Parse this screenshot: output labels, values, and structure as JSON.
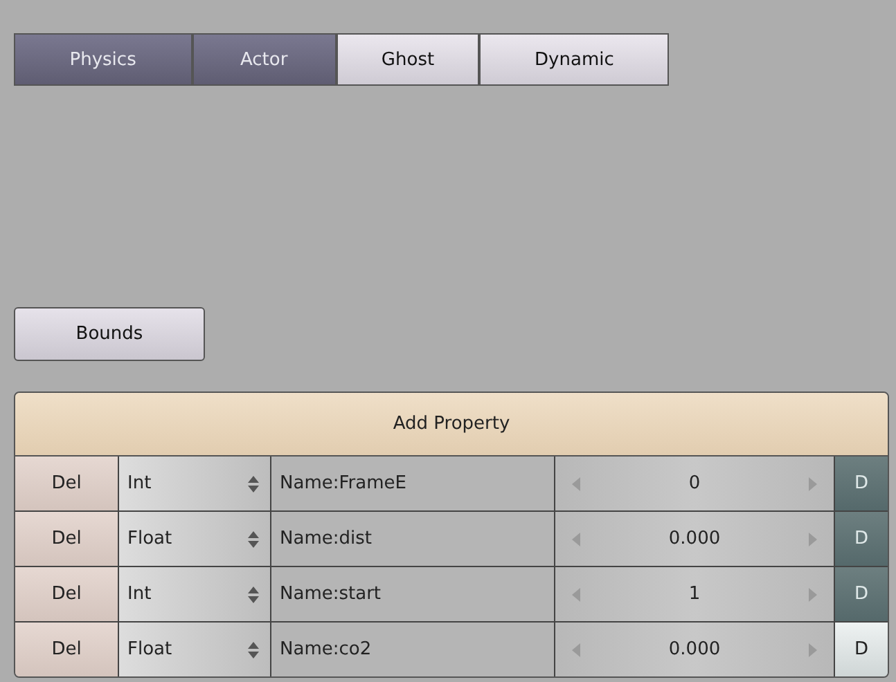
{
  "tabs": [
    {
      "label": "Physics",
      "selected": true
    },
    {
      "label": "Actor",
      "selected": true
    },
    {
      "label": "Ghost",
      "selected": false
    },
    {
      "label": "Dynamic",
      "selected": false
    }
  ],
  "bounds_button": "Bounds",
  "add_property_button": "Add Property",
  "properties": [
    {
      "delete": "Del",
      "type": "Int",
      "name": "Name:FrameE",
      "value": "0",
      "debug": "D",
      "debug_on": true
    },
    {
      "delete": "Del",
      "type": "Float",
      "name": "Name:dist",
      "value": "0.000",
      "debug": "D",
      "debug_on": true
    },
    {
      "delete": "Del",
      "type": "Int",
      "name": "Name:start",
      "value": "1",
      "debug": "D",
      "debug_on": true
    },
    {
      "delete": "Del",
      "type": "Float",
      "name": "Name:co2",
      "value": "0.000",
      "debug": "D",
      "debug_on": false
    }
  ]
}
